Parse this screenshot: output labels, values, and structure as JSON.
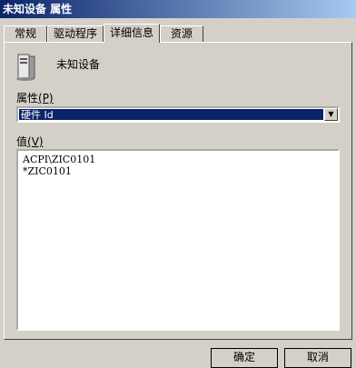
{
  "window": {
    "title": "未知设备 属性"
  },
  "tabs": [
    {
      "label": "常规"
    },
    {
      "label": "驱动程序"
    },
    {
      "label": "详细信息"
    },
    {
      "label": "资源"
    }
  ],
  "device": {
    "name": "未知设备",
    "icon": "unknown-device-icon"
  },
  "property": {
    "label": "属性",
    "hotkey": "(P)",
    "selected": "硬件 Id"
  },
  "values": {
    "label": "值",
    "hotkey": "(V)",
    "items": [
      "ACPI\\ZIC0101",
      "*ZIC0101"
    ]
  },
  "buttons": {
    "ok": "确定",
    "cancel": "取消"
  },
  "colors": {
    "accent": "#0a246a",
    "face": "#d4d0c8"
  }
}
